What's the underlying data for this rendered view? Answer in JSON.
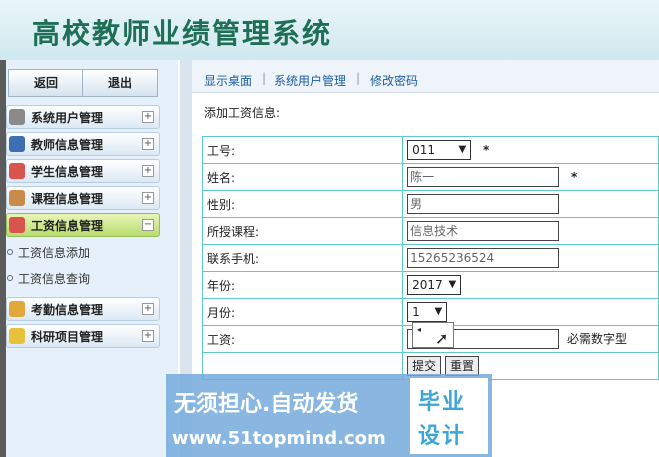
{
  "header": {
    "title": "高校教师业绩管理系统"
  },
  "sidebar": {
    "buttons": {
      "back": "返回",
      "exit": "退出"
    },
    "menus": [
      {
        "label": "系统用户管理",
        "toggle": "+"
      },
      {
        "label": "教师信息管理",
        "toggle": "+"
      },
      {
        "label": "学生信息管理",
        "toggle": "+"
      },
      {
        "label": "课程信息管理",
        "toggle": "+"
      },
      {
        "label": "工资信息管理",
        "toggle": "−"
      },
      {
        "label": "考勤信息管理",
        "toggle": "+"
      },
      {
        "label": "科研项目管理",
        "toggle": "+"
      }
    ],
    "submenu": [
      "工资信息添加",
      "工资信息查询"
    ]
  },
  "nav": {
    "links": [
      "显示桌面",
      "系统用户管理",
      "修改密码"
    ],
    "separator": "|"
  },
  "page": {
    "title": "添加工资信息:"
  },
  "form": {
    "labels": [
      "工号:",
      "姓名:",
      "性别:",
      "所授课程:",
      "联系手机:",
      "年份:",
      "月份:",
      "工资:"
    ],
    "values": {
      "id": "011",
      "name": "陈一",
      "gender": "男",
      "course": "信息技术",
      "phone": "15265236524",
      "year": "2017",
      "month": "1"
    },
    "required_mark": "*",
    "salary_hint": "必需数字型",
    "submit": "提交",
    "reset": "重置"
  },
  "watermark": {
    "line1": "无须担心.自动发货",
    "line2": "www.51topmind.com",
    "logo1": "毕业",
    "logo2": "设计"
  }
}
